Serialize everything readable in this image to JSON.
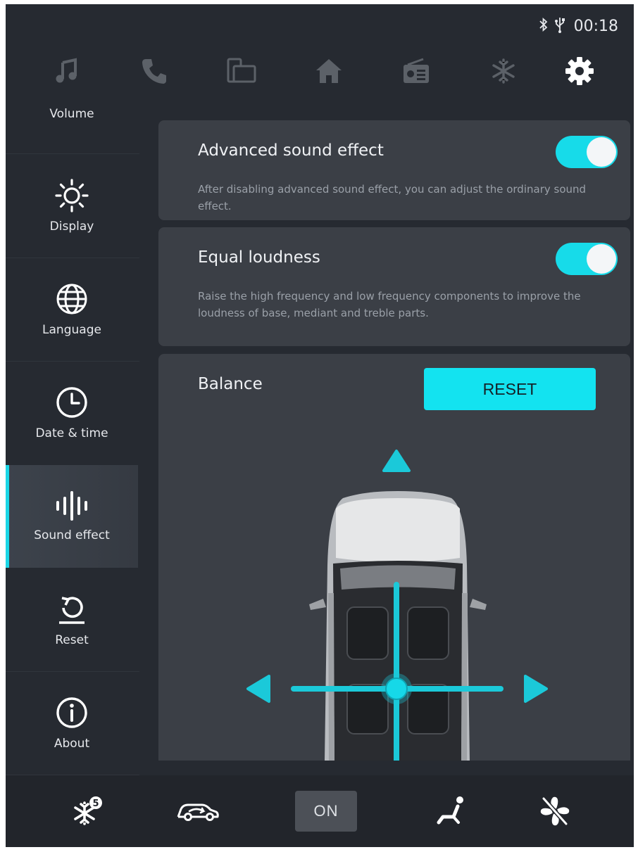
{
  "status": {
    "time": "00:18",
    "icons": [
      "bluetooth-icon",
      "usb-icon"
    ]
  },
  "topnav": [
    {
      "name": "music",
      "icon": "music-note-icon",
      "active": false
    },
    {
      "name": "phone",
      "icon": "phone-icon",
      "active": false
    },
    {
      "name": "screen-mirror",
      "icon": "screen-mirror-icon",
      "active": false
    },
    {
      "name": "home",
      "icon": "home-icon",
      "active": false
    },
    {
      "name": "radio",
      "icon": "radio-icon",
      "active": false
    },
    {
      "name": "climate",
      "icon": "snowflake-icon",
      "active": false
    },
    {
      "name": "settings",
      "icon": "gear-icon",
      "active": true
    }
  ],
  "sidebar": {
    "items": [
      {
        "label": "Volume",
        "icon": ""
      },
      {
        "label": "Display",
        "icon": "sun-icon"
      },
      {
        "label": "Language",
        "icon": "globe-icon"
      },
      {
        "label": "Date & time",
        "icon": "clock-icon"
      },
      {
        "label": "Sound effect",
        "icon": "sound-wave-icon",
        "active": true
      },
      {
        "label": "Reset",
        "icon": "restore-icon"
      },
      {
        "label": "About",
        "icon": "info-icon"
      }
    ]
  },
  "settings": {
    "advanced": {
      "title": "Advanced sound effect",
      "description": "After disabling advanced sound effect, you can adjust the ordinary sound effect.",
      "enabled": true
    },
    "loudness": {
      "title": "Equal loudness",
      "description": "Raise the high frequency and low frequency components to improve the loudness of base, mediant and treble parts.",
      "enabled": true
    },
    "balance": {
      "title": "Balance",
      "reset_label": "RESET"
    }
  },
  "bottombar": {
    "items": [
      {
        "name": "defrost",
        "icon": "snowflake-badge-icon",
        "badge": "5"
      },
      {
        "name": "recirculation",
        "icon": "car-air-icon"
      },
      {
        "name": "ac",
        "label": "ON"
      },
      {
        "name": "seat-heat",
        "icon": "seat-icon"
      },
      {
        "name": "fan",
        "icon": "fan-off-icon"
      }
    ]
  },
  "colors": {
    "accent": "#1bd6e6",
    "background": "#262a31",
    "panel": "#3b3f46"
  }
}
